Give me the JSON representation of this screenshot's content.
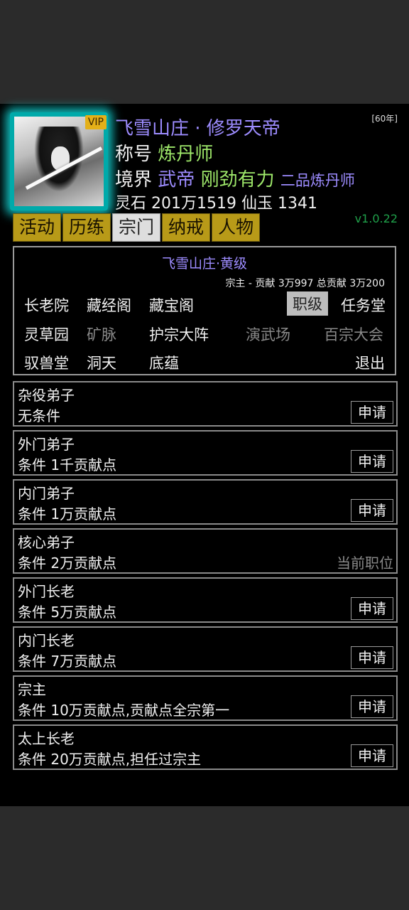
{
  "profile": {
    "vip_badge": "VIP",
    "name_line": "飞雪山庄 · 修罗天帝",
    "title_label": "称号",
    "title_value": "炼丹师",
    "realm_label": "境界",
    "realm_rank": "武帝",
    "realm_stage": "刚劲有力",
    "realm_extra": "二品炼丹师",
    "resources": "灵石 201万1519  仙玉 1341",
    "year_badge": "[60年]",
    "version": "v1.0.22"
  },
  "tabs": [
    {
      "label": "活动"
    },
    {
      "label": "历练"
    },
    {
      "label": "宗门",
      "active": true
    },
    {
      "label": "纳戒"
    },
    {
      "label": "人物"
    }
  ],
  "sect": {
    "name": "飞雪山庄·黄级",
    "contribution": "宗主 -  贡献 3万997  总贡献 3万200",
    "nav": [
      {
        "label": "长老院"
      },
      {
        "label": "藏经阁"
      },
      {
        "label": "藏宝阁"
      },
      {
        "label": "职级",
        "selected": true
      },
      {
        "label": "任务堂"
      },
      {
        "label": "灵草园"
      },
      {
        "label": "矿脉",
        "dim": true
      },
      {
        "label": "护宗大阵"
      },
      {
        "label": "演武场",
        "dim": true
      },
      {
        "label": "百宗大会",
        "dim": true
      },
      {
        "label": "驭兽堂"
      },
      {
        "label": "洞天"
      },
      {
        "label": "底蕴"
      },
      {
        "label": "退出"
      }
    ]
  },
  "positions": [
    {
      "title": "杂役弟子",
      "requirement": "无条件",
      "action": "申请"
    },
    {
      "title": "外门弟子",
      "requirement": "条件 1千贡献点",
      "action": "申请"
    },
    {
      "title": "内门弟子",
      "requirement": "条件 1万贡献点",
      "action": "申请"
    },
    {
      "title": "核心弟子",
      "requirement": "条件 2万贡献点",
      "status": "当前职位"
    },
    {
      "title": "外门长老",
      "requirement": "条件 5万贡献点",
      "action": "申请"
    },
    {
      "title": "内门长老",
      "requirement": "条件 7万贡献点",
      "action": "申请"
    },
    {
      "title": "宗主",
      "requirement": "条件 10万贡献点,贡献点全宗第一",
      "action": "申请"
    },
    {
      "title": "太上长老",
      "requirement": "条件 20万贡献点,担任过宗主",
      "action": "申请"
    }
  ],
  "colors": {
    "accent_purple": "#9d8cff",
    "accent_green": "#9ee86a",
    "tab_gold": "#b89a18",
    "glow_cyan": "#14dcdc"
  }
}
